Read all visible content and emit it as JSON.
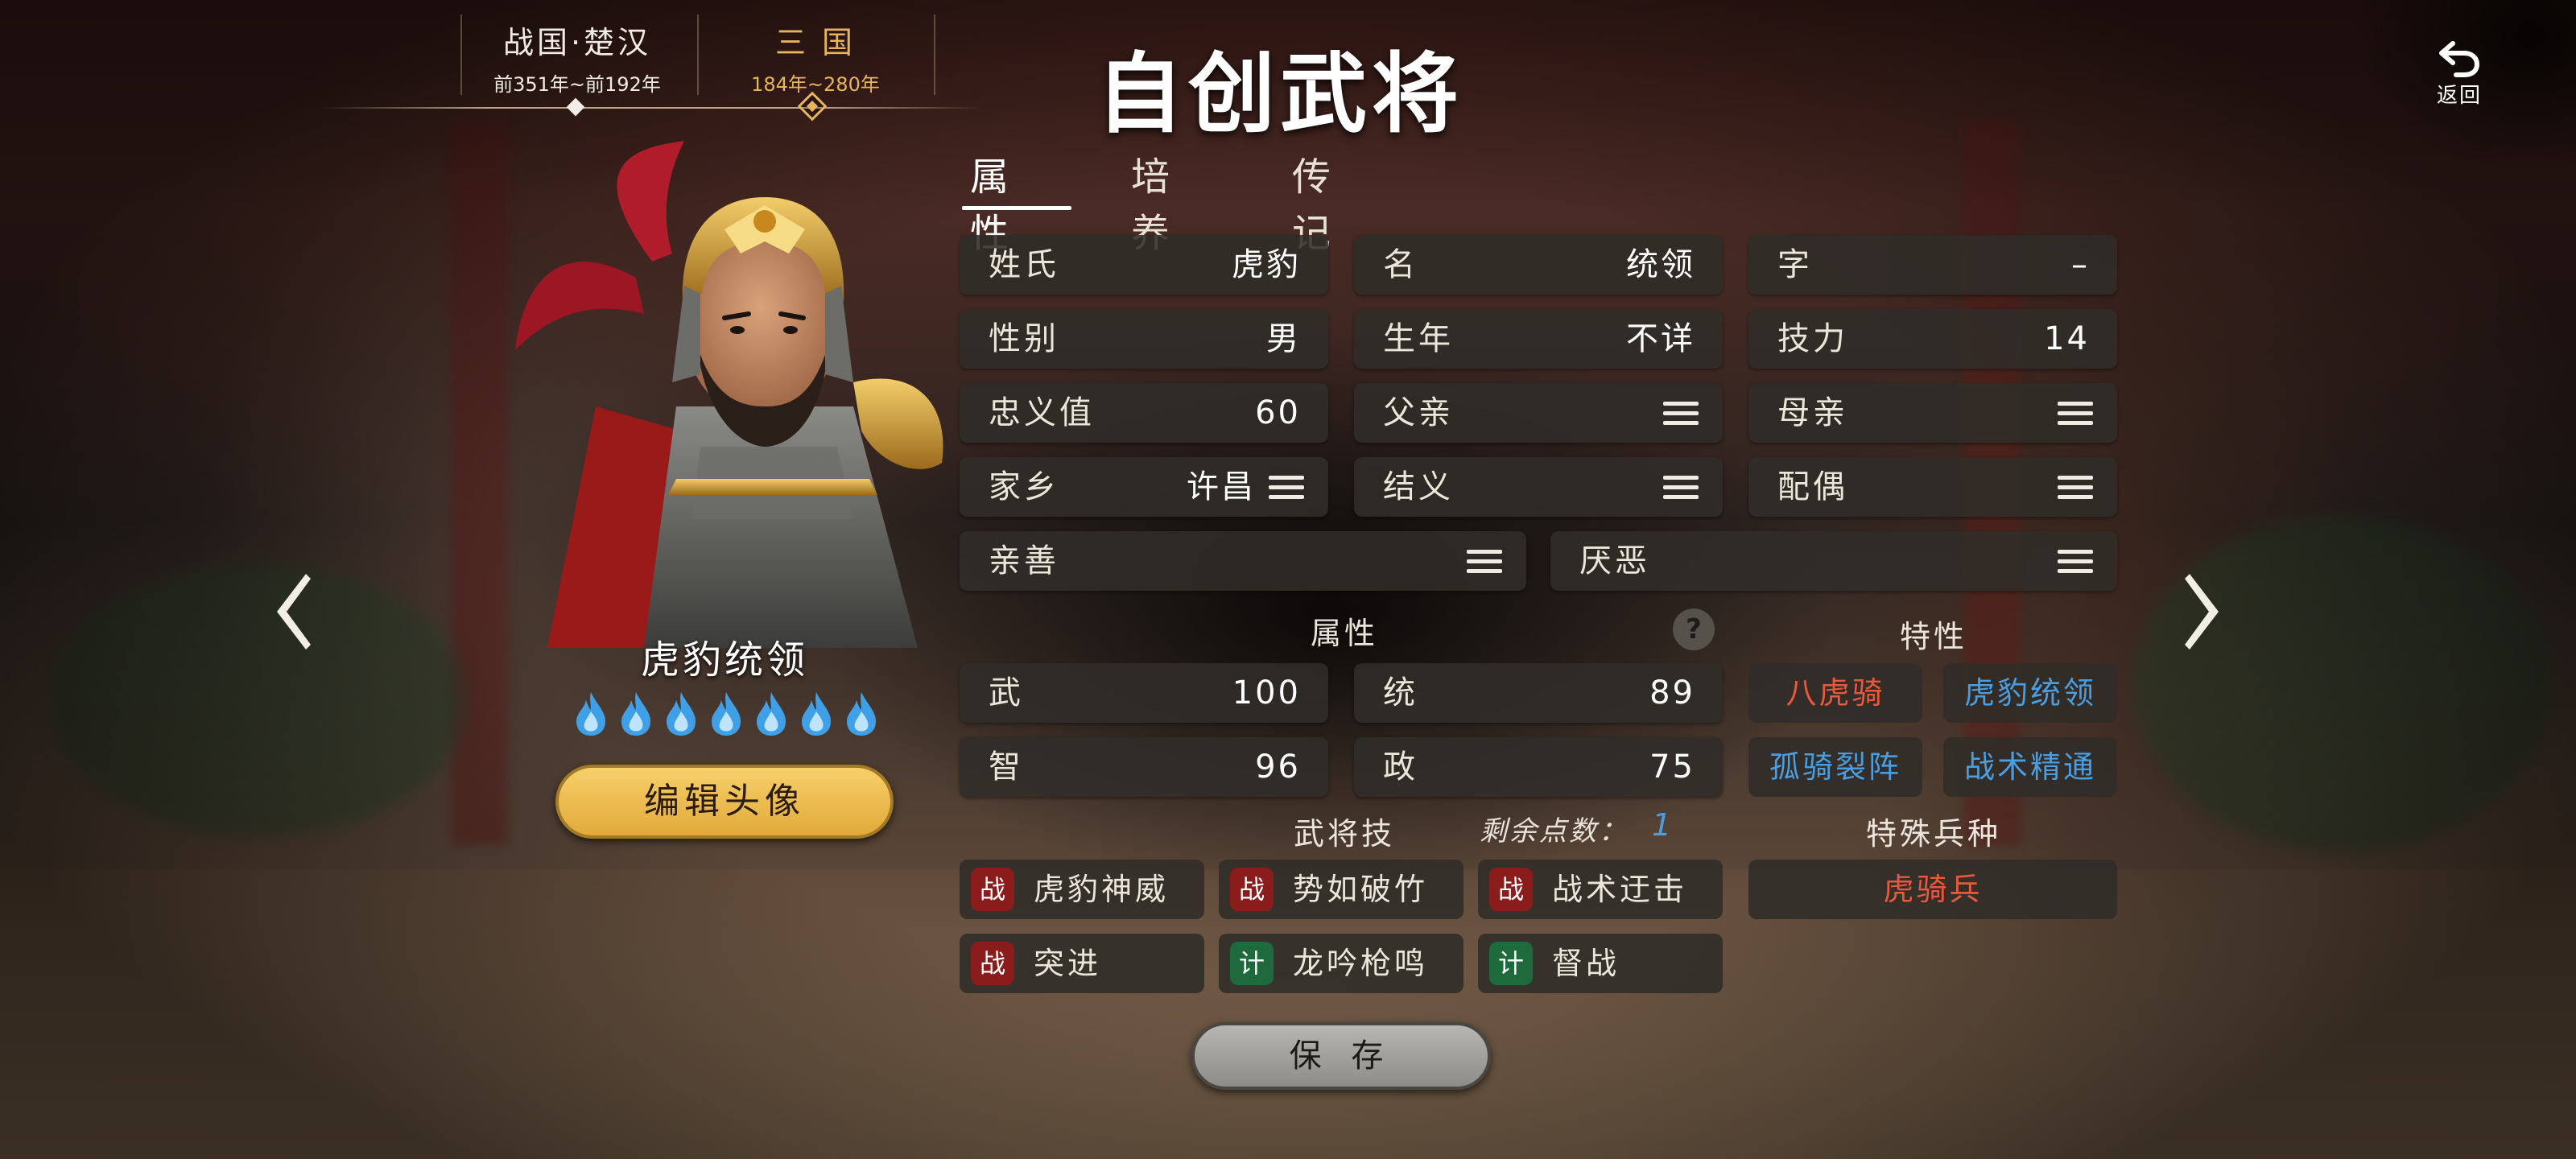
{
  "eras": [
    {
      "name": "战国·楚汉",
      "range": "前351年~前192年"
    },
    {
      "name": "三 国",
      "range": "184年~280年"
    }
  ],
  "title": "自创武将",
  "back_label": "返回",
  "tabs": [
    "属性",
    "培养",
    "传记"
  ],
  "character": {
    "name": "虎豹统领",
    "stars": 7,
    "edit_label": "编辑头像"
  },
  "fields": {
    "surname": {
      "label": "姓氏",
      "value": "虎豹"
    },
    "given": {
      "label": "名",
      "value": "统领"
    },
    "style": {
      "label": "字",
      "value": "–"
    },
    "gender": {
      "label": "性别",
      "value": "男"
    },
    "birth": {
      "label": "生年",
      "value": "不详"
    },
    "skill_power": {
      "label": "技力",
      "value": "14"
    },
    "loyalty": {
      "label": "忠义值",
      "value": "60"
    },
    "father": {
      "label": "父亲"
    },
    "mother": {
      "label": "母亲"
    },
    "hometown": {
      "label": "家乡",
      "value": "许昌"
    },
    "sworn": {
      "label": "结义"
    },
    "spouse": {
      "label": "配偶"
    },
    "likes": {
      "label": "亲善"
    },
    "dislikes": {
      "label": "厌恶"
    }
  },
  "attributes": {
    "header": "属性",
    "help": "?",
    "items": [
      {
        "label": "武",
        "value": "100"
      },
      {
        "label": "统",
        "value": "89"
      },
      {
        "label": "智",
        "value": "96"
      },
      {
        "label": "政",
        "value": "75"
      }
    ]
  },
  "traits": {
    "header": "特性",
    "items": [
      "八虎骑",
      "虎豹统领",
      "孤骑裂阵",
      "战术精通"
    ],
    "colors": {
      "red": "#e8593c",
      "blue": "#4a9ee0"
    }
  },
  "skills": {
    "header": "武将技",
    "points_label": "剩余点数：",
    "points_value": "1",
    "items": [
      {
        "type": "战",
        "name": "虎豹神威"
      },
      {
        "type": "战",
        "name": "势如破竹"
      },
      {
        "type": "战",
        "name": "战术迂击"
      },
      {
        "type": "战",
        "name": "突进"
      },
      {
        "type": "计",
        "name": "龙吟枪鸣"
      },
      {
        "type": "计",
        "name": "督战"
      }
    ]
  },
  "special_troop": {
    "header": "特殊兵种",
    "value": "虎骑兵"
  },
  "save_label": "保 存"
}
